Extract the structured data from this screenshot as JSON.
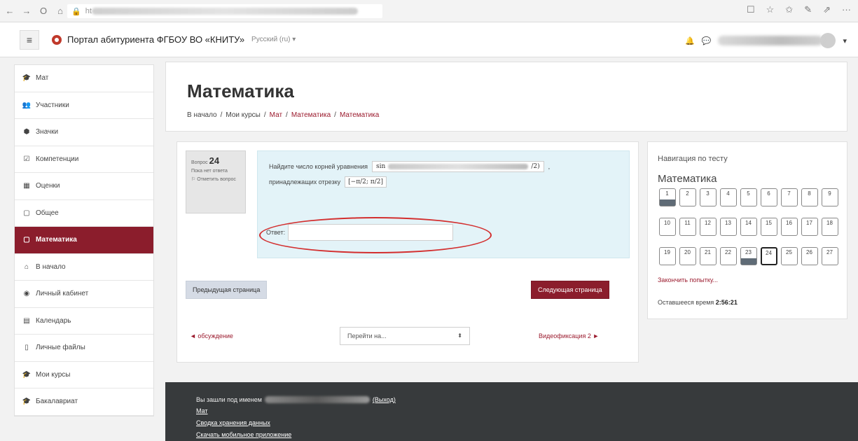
{
  "browser": {
    "back_icon": "←",
    "forward_icon": "→",
    "refresh_icon": "O",
    "home_icon": "⌂",
    "lock_icon": "🔒",
    "url_prefix": "ht",
    "right_icons": [
      "☐",
      "☆",
      "✩",
      "✎",
      "⇗",
      "···"
    ]
  },
  "topbar": {
    "menu_icon": "≡",
    "site_name": "Портал абитуриента ФГБОУ ВО «КНИТУ»",
    "language": "Русский (ru) ▾",
    "bell_icon": "🔔",
    "chat_icon": "💬",
    "user_caret": "▾"
  },
  "sidebar": {
    "items": [
      {
        "icon": "🎓",
        "label": "Мат",
        "active": false
      },
      {
        "icon": "👥",
        "label": "Участники",
        "active": false
      },
      {
        "icon": "⬢",
        "label": "Значки",
        "active": false
      },
      {
        "icon": "☑",
        "label": "Компетенции",
        "active": false
      },
      {
        "icon": "▦",
        "label": "Оценки",
        "active": false
      },
      {
        "icon": "▢",
        "label": "Общее",
        "active": false
      },
      {
        "icon": "▢",
        "label": "Математика",
        "active": true
      },
      {
        "icon": "⌂",
        "label": "В начало",
        "active": false
      },
      {
        "icon": "◉",
        "label": "Личный кабинет",
        "active": false
      },
      {
        "icon": "▤",
        "label": "Календарь",
        "active": false
      },
      {
        "icon": "▯",
        "label": "Личные файлы",
        "active": false
      },
      {
        "icon": "🎓",
        "label": "Мои курсы",
        "active": false
      },
      {
        "icon": "🎓",
        "label": "Бакалавриат",
        "active": false
      }
    ]
  },
  "header": {
    "title": "Математика",
    "breadcrumb": [
      "В начало",
      "Мои курсы",
      "Мат",
      "Математика",
      "Математика"
    ],
    "separator": "/"
  },
  "question": {
    "label": "Вопрос",
    "number": "24",
    "status": "Пока нет ответа",
    "flag_icon": "⚐",
    "flag_label": "Отметить вопрос",
    "text_before": "Найдите число корней уравнения",
    "formula_start": "sin",
    "formula_end": "/2)",
    "text_after": ",",
    "text_line2": "принадлежащих отрезку",
    "segment": "[−π/2; π/2]",
    "answer_label": "Ответ:",
    "answer_value": ""
  },
  "buttons": {
    "prev_page": "Предыдущая страница",
    "next_page": "Следующая страница"
  },
  "activity_nav": {
    "prev": "◄ обсуждение",
    "jump_placeholder": "Перейти на...",
    "jump_arrow": "⬍",
    "next": "Видеофиксация 2 ►"
  },
  "quiz_nav": {
    "title": "Навигация по тесту",
    "quiz_name": "Математика",
    "questions": [
      {
        "n": "1",
        "state": "answered"
      },
      {
        "n": "2",
        "state": ""
      },
      {
        "n": "3",
        "state": ""
      },
      {
        "n": "4",
        "state": ""
      },
      {
        "n": "5",
        "state": ""
      },
      {
        "n": "6",
        "state": ""
      },
      {
        "n": "7",
        "state": ""
      },
      {
        "n": "8",
        "state": ""
      },
      {
        "n": "9",
        "state": ""
      },
      {
        "n": "10",
        "state": ""
      },
      {
        "n": "11",
        "state": ""
      },
      {
        "n": "12",
        "state": ""
      },
      {
        "n": "13",
        "state": ""
      },
      {
        "n": "14",
        "state": ""
      },
      {
        "n": "15",
        "state": ""
      },
      {
        "n": "16",
        "state": ""
      },
      {
        "n": "17",
        "state": ""
      },
      {
        "n": "18",
        "state": ""
      },
      {
        "n": "19",
        "state": ""
      },
      {
        "n": "20",
        "state": ""
      },
      {
        "n": "21",
        "state": ""
      },
      {
        "n": "22",
        "state": ""
      },
      {
        "n": "23",
        "state": "answered"
      },
      {
        "n": "24",
        "state": "current"
      },
      {
        "n": "25",
        "state": ""
      },
      {
        "n": "26",
        "state": ""
      },
      {
        "n": "27",
        "state": ""
      }
    ],
    "finish_link": "Закончить попытку...",
    "time_label": "Оставшееся время",
    "time_value": "2:56:21"
  },
  "footer": {
    "logged_in_as": "Вы зашли под именем",
    "logout": "(Выход)",
    "course_link": "Мат",
    "data_retention": "Сводка хранения данных",
    "mobile_app": "Скачать мобильное приложение"
  },
  "colors": {
    "accent": "#8b1d2c",
    "link": "#9b1b2e",
    "question_bg": "#e3f3f8",
    "footer_bg": "#373a3c",
    "annotation": "#d32f2f"
  }
}
